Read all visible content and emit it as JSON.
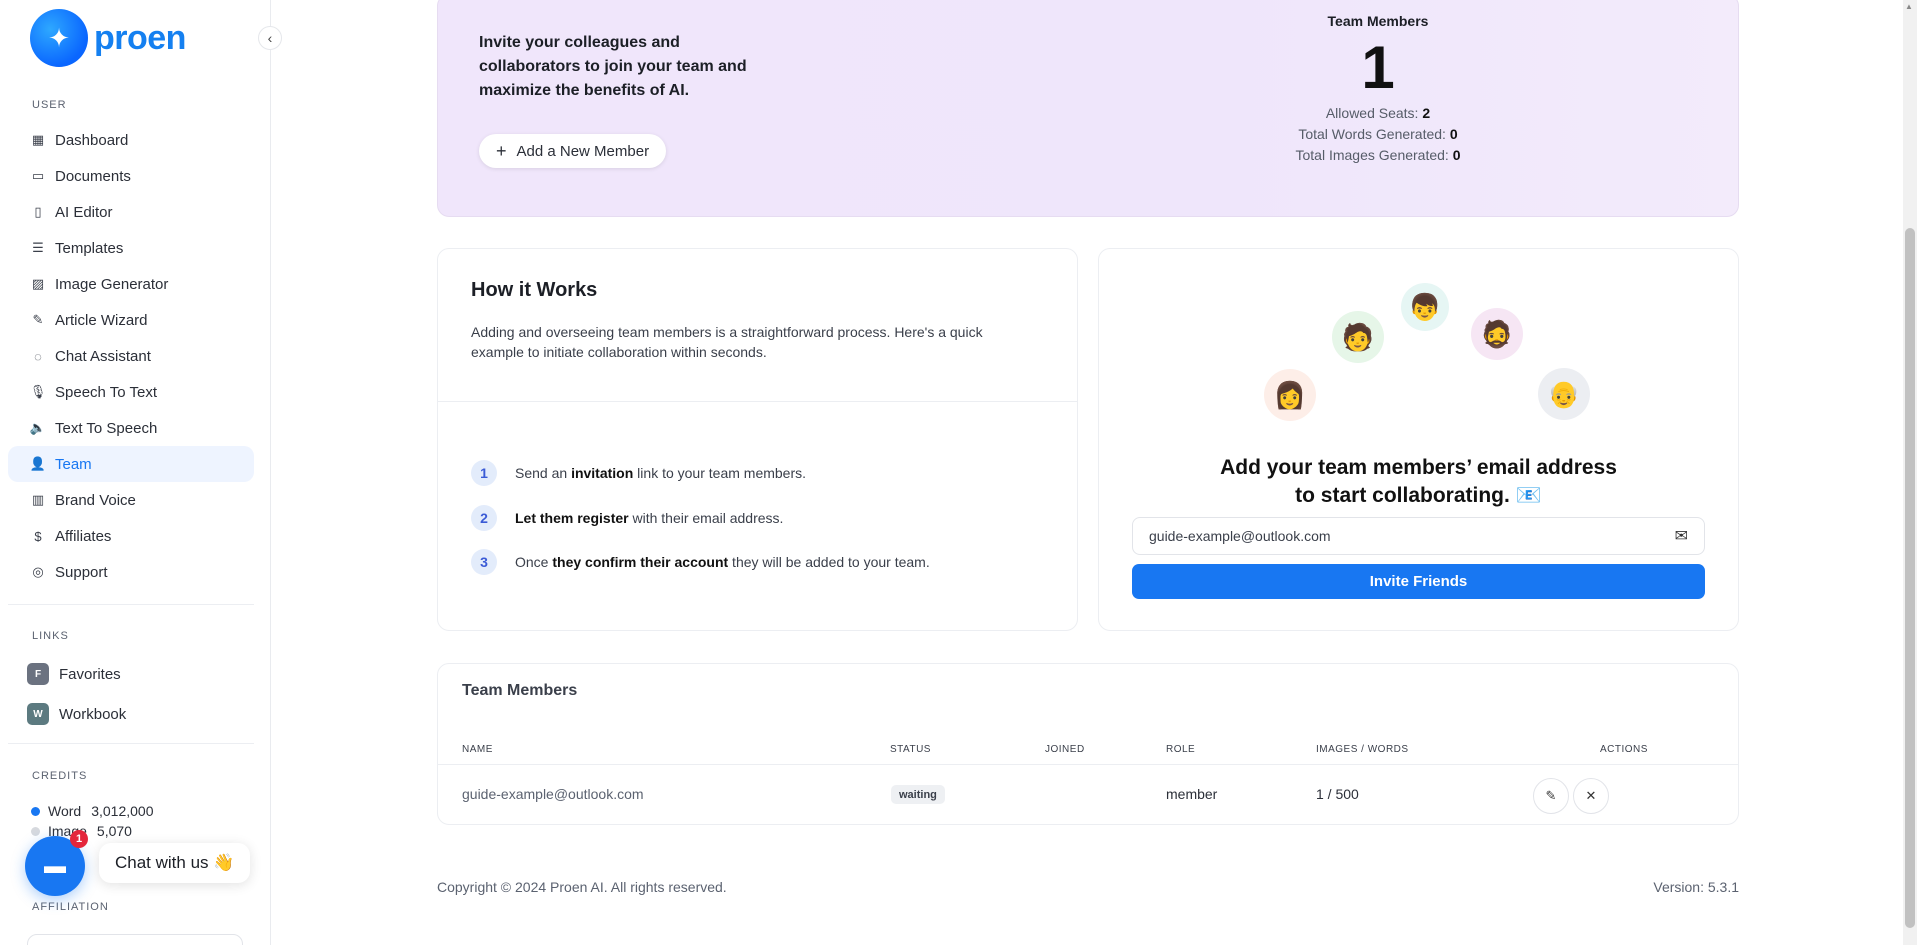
{
  "brand": {
    "name": "proen"
  },
  "sidebar": {
    "user_section": "USER",
    "items": [
      {
        "label": "Dashboard",
        "icon": "dashboard-icon"
      },
      {
        "label": "Documents",
        "icon": "archive-icon"
      },
      {
        "label": "AI Editor",
        "icon": "book-icon"
      },
      {
        "label": "Templates",
        "icon": "file-text-icon"
      },
      {
        "label": "Image Generator",
        "icon": "image-icon"
      },
      {
        "label": "Article Wizard",
        "icon": "file-edit-icon"
      },
      {
        "label": "Chat Assistant",
        "icon": "message-circle-icon"
      },
      {
        "label": "Speech To Text",
        "icon": "microphone-icon"
      },
      {
        "label": "Text To Speech",
        "icon": "speaker-icon"
      },
      {
        "label": "Team",
        "icon": "user-plus-icon",
        "active": true
      },
      {
        "label": "Brand Voice",
        "icon": "layout-icon"
      },
      {
        "label": "Affiliates",
        "icon": "dollar-icon"
      },
      {
        "label": "Support",
        "icon": "lifebuoy-icon"
      }
    ],
    "links_section": "LINKS",
    "links": [
      {
        "badge": "F",
        "label": "Favorites"
      },
      {
        "badge": "W",
        "label": "Workbook"
      }
    ],
    "credits_section": "CREDITS",
    "credits": [
      {
        "label": "Word",
        "value": "3,012,000",
        "color": "#1877f2"
      },
      {
        "label": "Image",
        "value": "5,070",
        "color": "#d6d9de"
      }
    ],
    "affiliation_section": "AFFILIATION"
  },
  "chat": {
    "count": "1",
    "label": "Chat with us 👋"
  },
  "hero": {
    "text": "Invite your colleagues and collaborators to join your team and maximize the benefits of AI.",
    "add_button": "Add a New Member",
    "team_members_label": "Team Members",
    "team_members_count": "1",
    "allowed_seats_label": "Allowed Seats:",
    "allowed_seats": "2",
    "words_label": "Total Words Generated:",
    "words": "0",
    "images_label": "Total Images Generated:",
    "images": "0"
  },
  "how": {
    "title": "How it Works",
    "desc": "Adding and overseeing team members is a straightforward process. Here's a quick example to initiate collaboration within seconds.",
    "steps": [
      {
        "num": "1",
        "pre": "Send an ",
        "bold": "invitation",
        "post": " link to your team members."
      },
      {
        "num": "2",
        "pre": "",
        "bold": "Let them register",
        "post": " with their email address."
      },
      {
        "num": "3",
        "pre": "Once ",
        "bold": "they confirm their account",
        "post": " they will be added to your team."
      }
    ]
  },
  "invite": {
    "heading_line1": "Add your team members’ email address",
    "heading_line2": "to start collaborating. 📧",
    "email_value": "guide-example@outlook.com",
    "button": "Invite Friends"
  },
  "members": {
    "title": "Team Members",
    "columns": [
      "NAME",
      "STATUS",
      "JOINED",
      "ROLE",
      "IMAGES / WORDS",
      "ACTIONS"
    ],
    "rows": [
      {
        "name": "guide-example@outlook.com",
        "status": "waiting",
        "joined": "",
        "role": "member",
        "usage": "1 / 500"
      }
    ]
  },
  "footer": {
    "copyright": "Copyright © 2024 Proen AI. All rights reserved.",
    "version": "Version: 5.3.1"
  }
}
